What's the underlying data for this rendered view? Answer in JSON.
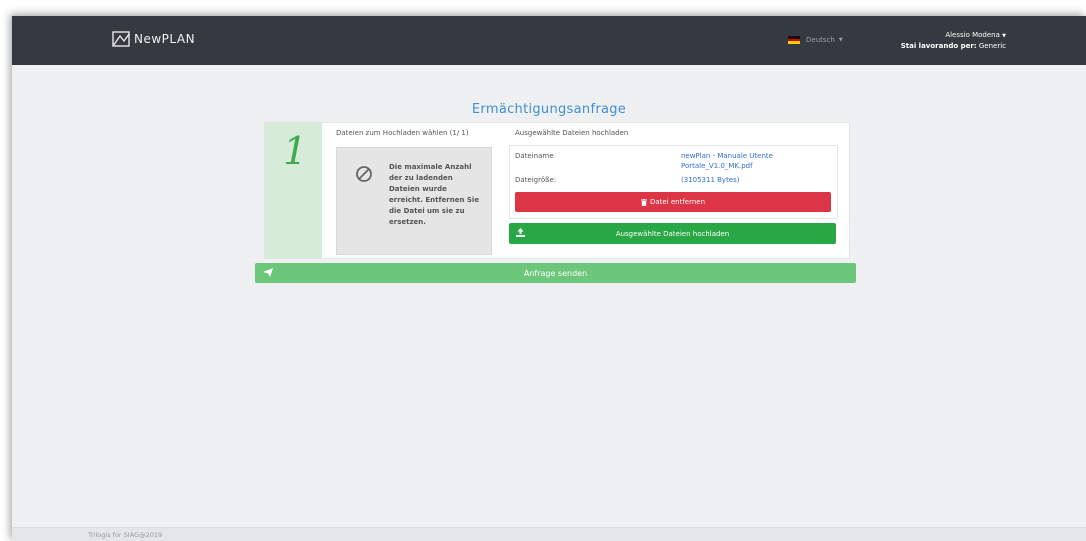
{
  "header": {
    "brand": "NewPLAN",
    "language": "Deutsch",
    "user_name": "Alessio Modena",
    "working_for_label": "Stai lavorando per:",
    "working_for_value": "Generic"
  },
  "page": {
    "title": "Ermächtigungsanfrage"
  },
  "step": {
    "number": "1",
    "choose_files_heading": "Dateien zum Hochladen wählen (1/ 1)",
    "max_files_message": "Die maximale Anzahl der zu ladenden Dateien wurde erreicht. Entfernen Sie die Datei um sie zu ersetzen.",
    "upload_heading": "Ausgewählte Dateien hochladen",
    "file": {
      "name_label": "Dateiname",
      "name_value": "newPlan - Manuale Utente Portale_V1.0_MK.pdf",
      "size_label": "Dateigröße:",
      "size_value": "(3105311 Bytes)"
    },
    "remove_button": "Datei entfernen",
    "upload_button": "Ausgewählte Dateien hochladen"
  },
  "send_button": "Anfrage senden",
  "footer": {
    "text": "Trilogis for SIAG@2019"
  },
  "colors": {
    "navbar": "#343a40",
    "title": "#3f8fd4",
    "danger": "#dc3545",
    "success": "#28a745",
    "send": "#6cc77a",
    "step_bg": "#d6ecd9"
  }
}
